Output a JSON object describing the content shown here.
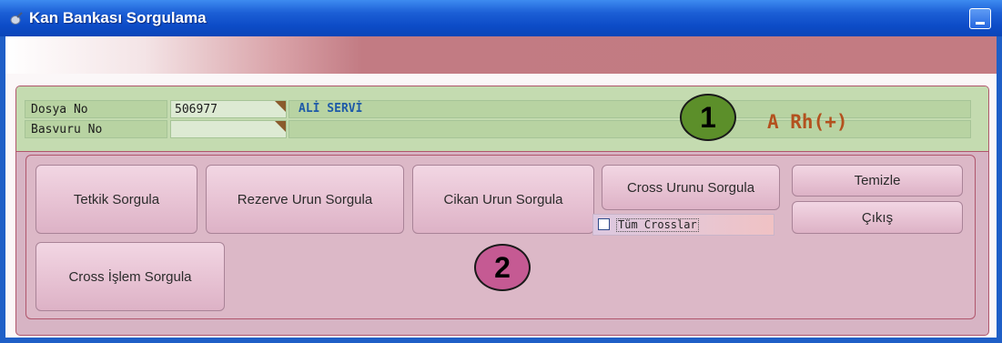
{
  "window": {
    "title": "Kan Bankası Sorgulama",
    "minimize_label": "",
    "title_bar_color": "#1c5fd6"
  },
  "patient": {
    "dosya_no_label": "Dosya No",
    "dosya_no_value": "506977",
    "basvuru_no_label": "Basvuru No",
    "basvuru_no_value": "",
    "name": "ALİ SERVİ",
    "blood_type": "A Rh(+)"
  },
  "annotations": {
    "marker_1": "1",
    "marker_2": "2",
    "marker_1_color": "#5c8f2a",
    "marker_2_color": "#c55a93"
  },
  "buttons": {
    "tetkik": "Tetkik Sorgula",
    "rezerve": "Rezerve Urun Sorgula",
    "cikan": "Cikan Urun Sorgula",
    "cross_urunu": "Cross Urunu Sorgula",
    "temizle": "Temizle",
    "cikis": "Çıkış",
    "cross_islem": "Cross İşlem Sorgula"
  },
  "options": {
    "tum_crosslar_label": "Tüm Crosslar",
    "tum_crosslar_checked": false
  }
}
